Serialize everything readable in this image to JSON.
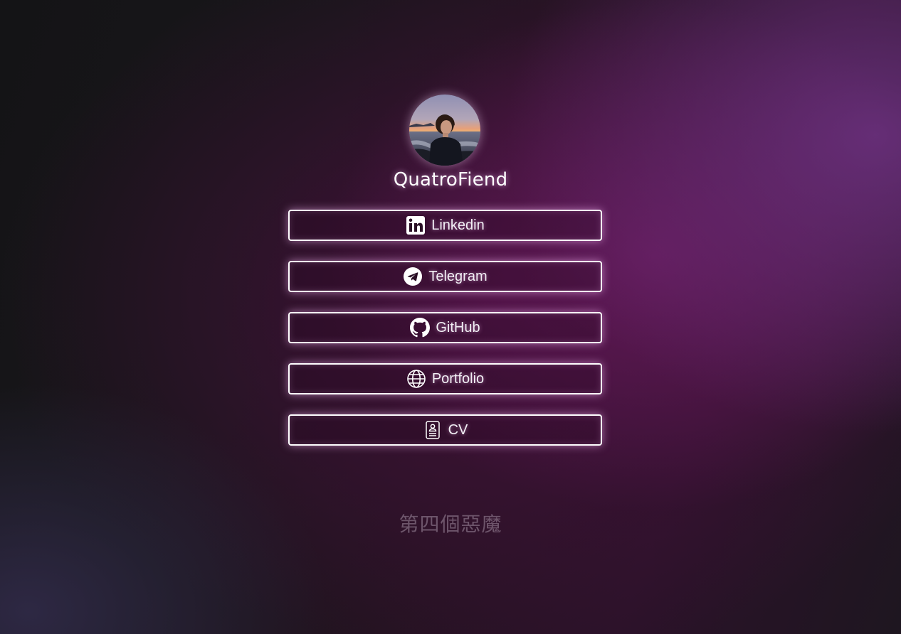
{
  "profile": {
    "name": "QuatroFiend",
    "avatar_alt": "avatar"
  },
  "links": [
    {
      "label": "Linkedin",
      "icon": "linkedin-icon"
    },
    {
      "label": "Telegram",
      "icon": "telegram-icon"
    },
    {
      "label": "GitHub",
      "icon": "github-icon"
    },
    {
      "label": "Portfolio",
      "icon": "globe-icon"
    },
    {
      "label": "CV",
      "icon": "id-card-icon"
    }
  ],
  "footer": {
    "text": "第四個惡魔"
  },
  "colors": {
    "button_border": "#ffffff",
    "glow": "#ffbeff",
    "footer_text": "#a08ca0"
  }
}
